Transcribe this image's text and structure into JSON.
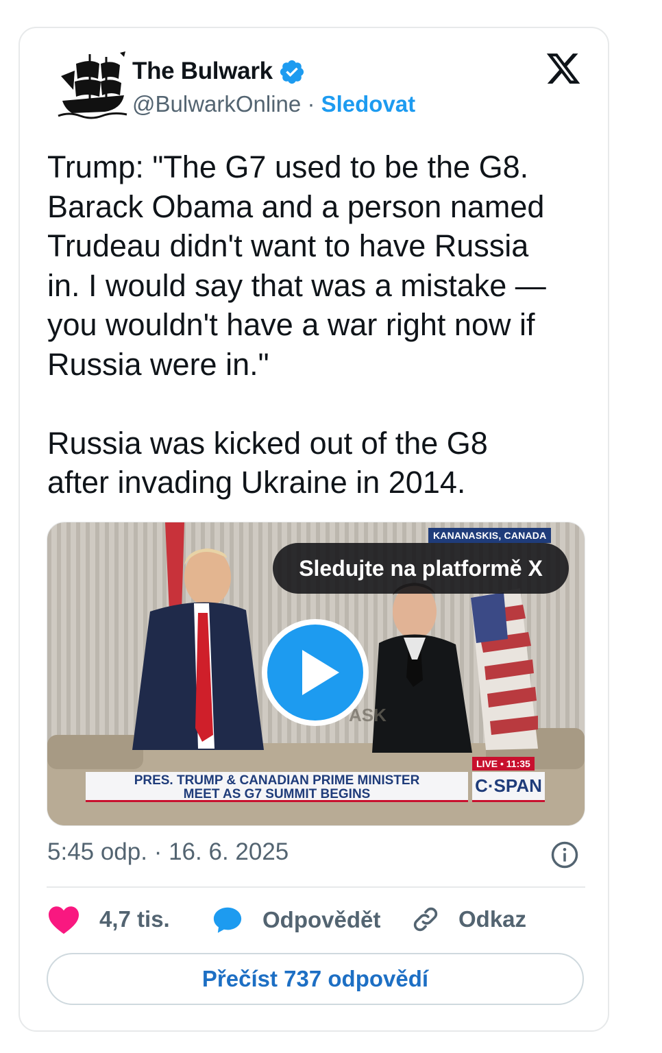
{
  "author": {
    "name": "The Bulwark",
    "handle": "@BulwarkOnline",
    "separator": "·",
    "follow_label": "Sledovat"
  },
  "tweet": {
    "text": "Trump: \"The G7 used to be the G8.\nBarack Obama and a person named\nTrudeau didn't want to have Russia\nin. I would say that was a mistake —\nyou wouldn't have a war right now if\nRussia were in.\"\n\nRussia was kicked out of the G8\nafter invading Ukraine in 2014."
  },
  "media": {
    "watch_label": "Sledujte na platformě X",
    "location_tag": "KANANASKIS, CANADA",
    "live_tag": "LIVE • 11:35",
    "lower_third": "PRES. TRUMP & CANADIAN PRIME MINISTER\nMEET AS G7 SUMMIT BEGINS",
    "channel": "C·SPAN"
  },
  "meta": {
    "time": "5:45 odp.",
    "separator": "·",
    "date": "16. 6. 2025"
  },
  "actions": {
    "likes": "4,7 tis.",
    "reply_label": "Odpovědět",
    "link_label": "Odkaz"
  },
  "read_replies_label": "Přečíst 737 odpovědí",
  "colors": {
    "accent": "#1d9bf0",
    "like": "#f91880",
    "text": "#0f1419",
    "secondary": "#536471",
    "border": "#e7e9ea"
  },
  "icons": [
    "bulwark-ship-logo",
    "verified-badge-icon",
    "x-logo-icon",
    "play-icon",
    "info-icon",
    "heart-icon",
    "reply-bubble-icon",
    "link-icon"
  ]
}
